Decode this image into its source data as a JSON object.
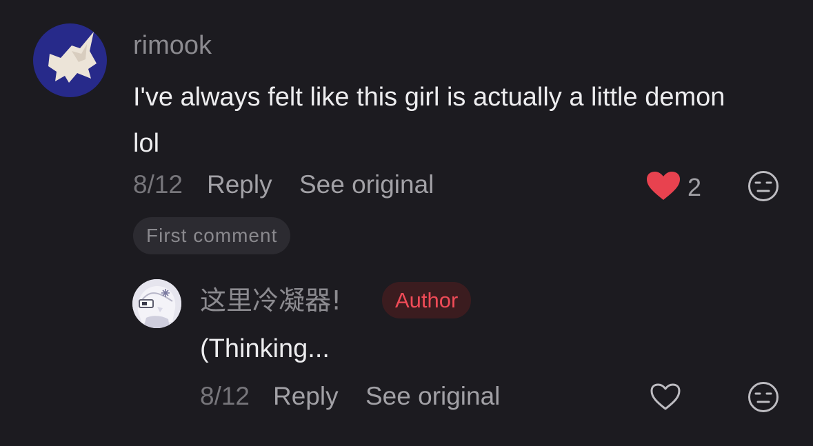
{
  "comment": {
    "username": "rimook",
    "text": "I've always felt like this girl is actually a little demon lol",
    "date": "8/12",
    "reply_label": "Reply",
    "see_original_label": "See original",
    "like_count": "2",
    "liked": true,
    "badge": "First comment",
    "avatar_color": "#272a8a"
  },
  "reply": {
    "username": "这里冷凝器!",
    "author_badge": "Author",
    "text": "(Thinking...",
    "date": "8/12",
    "reply_label": "Reply",
    "see_original_label": "See original",
    "liked": false
  },
  "colors": {
    "background": "#1c1b20",
    "heart": "#e8424f",
    "author_badge_text": "#ef4b57"
  },
  "icons": {
    "like": "heart-icon",
    "reaction": "neutral-face-icon"
  }
}
